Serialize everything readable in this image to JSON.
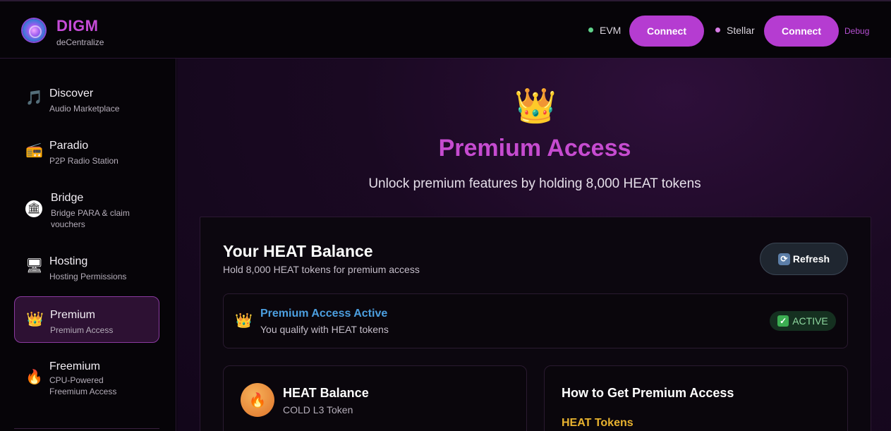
{
  "header": {
    "brand_title": "DIGM",
    "brand_subtitle": "deCentralize",
    "networks": [
      {
        "label": "EVM",
        "dot_color": "#5fd28a",
        "button_label": "Connect"
      },
      {
        "label": "Stellar",
        "dot_color": "#d77be6",
        "button_label": "Connect"
      }
    ],
    "debug_label": "Debug"
  },
  "sidebar": {
    "items": [
      {
        "icon": "music-note-icon",
        "label": "Discover",
        "sub": "Audio Marketplace"
      },
      {
        "icon": "radio-icon",
        "label": "Paradio",
        "sub": "P2P Radio Station"
      },
      {
        "icon": "pillar-icon",
        "label": "Bridge",
        "sub": "Bridge PARA & claim vouchers"
      },
      {
        "icon": "monitor-icon",
        "label": "Hosting",
        "sub": "Hosting Permissions"
      },
      {
        "icon": "crown-icon",
        "label": "Premium",
        "sub": "Premium Access",
        "active": true
      },
      {
        "icon": "fire-icon",
        "label": "Freemium",
        "sub": "CPU-Powered Freemium Access"
      }
    ]
  },
  "main": {
    "hero_icon": "crown-icon",
    "title": "Premium Access",
    "subtitle": "Unlock premium features by holding 8,000 HEAT tokens",
    "balance_panel": {
      "title": "Your HEAT Balance",
      "subtitle": "Hold 8,000 HEAT tokens for premium access",
      "refresh_label": "Refresh",
      "status": {
        "title": "Premium Access Active",
        "subtitle": "You qualify with HEAT tokens",
        "badge": "ACTIVE"
      },
      "heat_card": {
        "title": "HEAT Balance",
        "subtitle": "COLD L3 Token"
      },
      "howto_card": {
        "title": "How to Get Premium Access",
        "section": "HEAT Tokens"
      }
    }
  },
  "colors": {
    "accent": "#b53cd1",
    "title_pink": "#c64bd0",
    "status_blue": "#4c9fe0",
    "heat_gold": "#e9b32f"
  }
}
